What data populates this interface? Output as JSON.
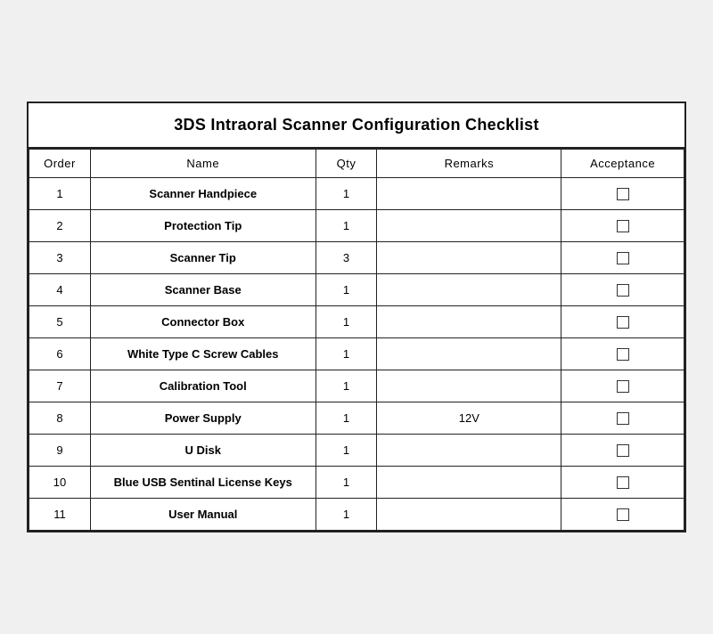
{
  "title": "3DS Intraoral Scanner Configuration Checklist",
  "columns": {
    "order": "Order",
    "name": "Name",
    "qty": "Qty",
    "remarks": "Remarks",
    "acceptance": "Acceptance"
  },
  "rows": [
    {
      "order": "1",
      "name": "Scanner Handpiece",
      "qty": "1",
      "remarks": ""
    },
    {
      "order": "2",
      "name": "Protection Tip",
      "qty": "1",
      "remarks": ""
    },
    {
      "order": "3",
      "name": "Scanner Tip",
      "qty": "3",
      "remarks": ""
    },
    {
      "order": "4",
      "name": "Scanner Base",
      "qty": "1",
      "remarks": ""
    },
    {
      "order": "5",
      "name": "Connector Box",
      "qty": "1",
      "remarks": ""
    },
    {
      "order": "6",
      "name": "White Type C Screw Cables",
      "qty": "1",
      "remarks": ""
    },
    {
      "order": "7",
      "name": "Calibration Tool",
      "qty": "1",
      "remarks": ""
    },
    {
      "order": "8",
      "name": "Power Supply",
      "qty": "1",
      "remarks": "12V"
    },
    {
      "order": "9",
      "name": "U Disk",
      "qty": "1",
      "remarks": ""
    },
    {
      "order": "10",
      "name": "Blue USB Sentinal License Keys",
      "qty": "1",
      "remarks": ""
    },
    {
      "order": "11",
      "name": "User Manual",
      "qty": "1",
      "remarks": ""
    }
  ]
}
